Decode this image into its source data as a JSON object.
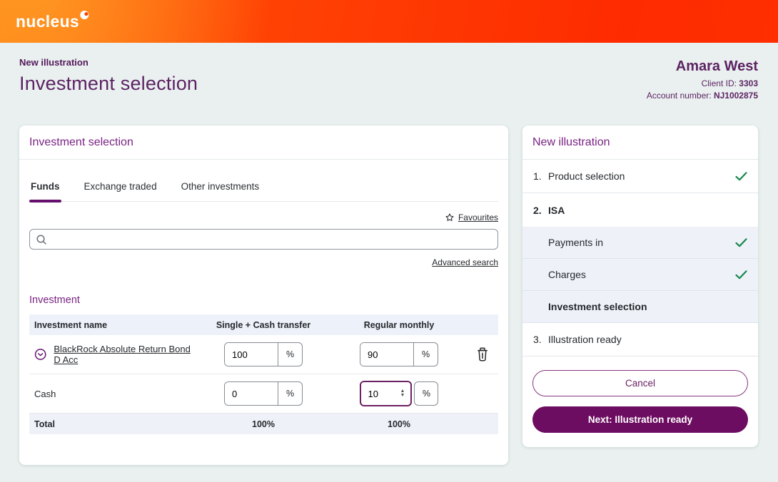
{
  "header": {
    "logo": "nucleus"
  },
  "page": {
    "breadcrumb": "New illustration",
    "title": "Investment selection",
    "client": {
      "name": "Amara West",
      "id_label": "Client ID:",
      "id_value": "3303",
      "account_label": "Account number:",
      "account_value": "NJ1002875"
    }
  },
  "panel": {
    "title": "Investment selection",
    "tabs": [
      "Funds",
      "Exchange traded",
      "Other investments"
    ],
    "favourites": "Favourites",
    "search_value": "",
    "advanced_search": "Advanced search",
    "section": "Investment",
    "columns": {
      "name": "Investment name",
      "single": "Single + Cash transfer",
      "regular": "Regular monthly"
    },
    "percent": "%",
    "rows": [
      {
        "name": "BlackRock Absolute Return Bond D Acc",
        "single": "100",
        "regular": "90"
      },
      {
        "name": "Cash",
        "single": "0",
        "regular": "10"
      }
    ],
    "total": {
      "label": "Total",
      "single": "100%",
      "regular": "100%"
    }
  },
  "steps": {
    "title": "New illustration",
    "items": [
      {
        "num": "1.",
        "label": "Product selection",
        "done": true
      },
      {
        "num": "2.",
        "label": "ISA",
        "done": false
      },
      {
        "num": "",
        "label": "Payments in",
        "done": true
      },
      {
        "num": "",
        "label": "Charges",
        "done": true
      },
      {
        "num": "",
        "label": "Investment selection",
        "done": false
      },
      {
        "num": "3.",
        "label": "Illustration ready",
        "done": false
      }
    ],
    "cancel": "Cancel",
    "next": "Next: Illustration ready"
  },
  "colors": {
    "header_gradient_start": "#ff7f16",
    "header_gradient_end": "#fe2b00",
    "brand_purple": "#65106c",
    "heading_purple": "#792383",
    "primary_button": "#6d0d61",
    "success_green": "#17874f",
    "row_highlight": "#edf1f9",
    "page_background": "#e9f0ef"
  }
}
